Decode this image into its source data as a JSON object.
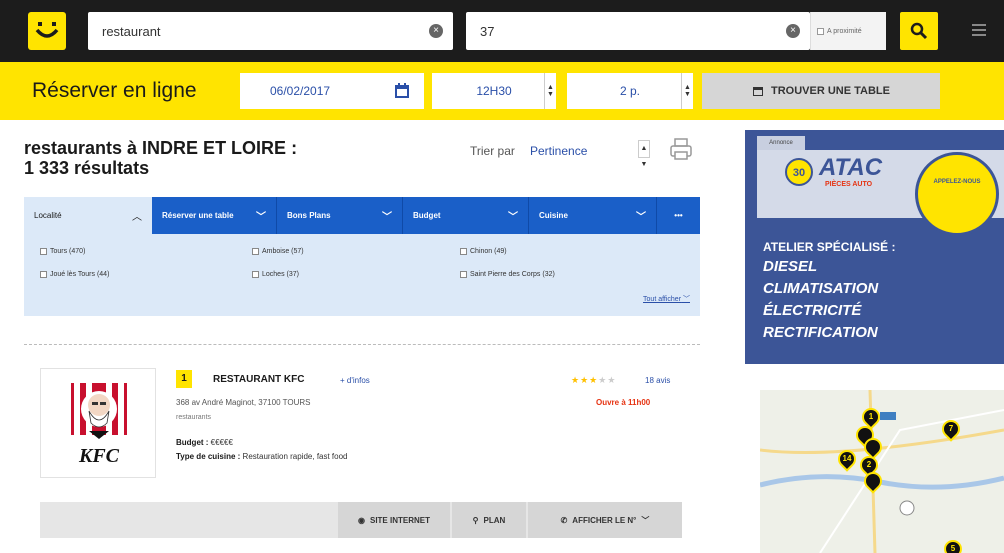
{
  "colors": {
    "brand_yellow": "#ffe400",
    "topbar": "#1c1c1c",
    "filter_blue": "#1a5fc8",
    "link_blue": "#2a4fa8",
    "open_red": "#e63312"
  },
  "search": {
    "what": "restaurant",
    "where": "37",
    "proximity_label": "A proximité"
  },
  "booking": {
    "title": "Réserver en ligne",
    "date": "06/02/2017",
    "time": "12H30",
    "people": "2 p.",
    "find_label": "TROUVER UNE TABLE"
  },
  "results": {
    "title_line1": "restaurants à INDRE ET LOIRE :",
    "title_line2": "1 333 résultats",
    "sort_label": "Trier par",
    "sort_value": "Pertinence"
  },
  "filters": {
    "tabs": [
      {
        "label": "Localité"
      },
      {
        "label": "Réserver une table"
      },
      {
        "label": "Bons Plans"
      },
      {
        "label": "Budget"
      },
      {
        "label": "Cuisine"
      },
      {
        "label": "•••"
      }
    ],
    "options": [
      "Tours (470)",
      "Amboise (57)",
      "Chinon (49)",
      "Joué lès Tours (44)",
      "Loches (37)",
      "Saint Pierre des Corps (32)"
    ],
    "show_all": "Tout afficher"
  },
  "listing": {
    "rank": "1",
    "name": "RESTAURANT KFC",
    "more_info": "+ d'infos",
    "address": "368 av André Maginot, 37100 TOURS",
    "category": "restaurants",
    "budget_label": "Budget :",
    "budget_value": "€€€€€",
    "cuisine_label": "Type de cuisine :",
    "cuisine_value": "Restauration rapide,  fast food",
    "rating": 3,
    "rating_max": 5,
    "reviews": "18 avis",
    "open_status": "Ouvre à 11h00",
    "logo_text": "KFC",
    "actions": {
      "website": "SITE INTERNET",
      "map": "PLAN",
      "phone": "AFFICHER LE N°"
    }
  },
  "ad": {
    "tag": "Annonce",
    "brand": "ATAC",
    "brand_sub": "PIÈCES AUTO",
    "badge": "APPELEZ-NOUS",
    "line1": "ATELIER SPÉCIALISÉ :",
    "lines": [
      "DIESEL",
      "CLIMATISATION",
      "ÉLECTRICITÉ",
      "RECTIFICATION"
    ]
  },
  "map": {
    "pins": [
      "1",
      "14",
      "2",
      "7",
      "5"
    ]
  }
}
